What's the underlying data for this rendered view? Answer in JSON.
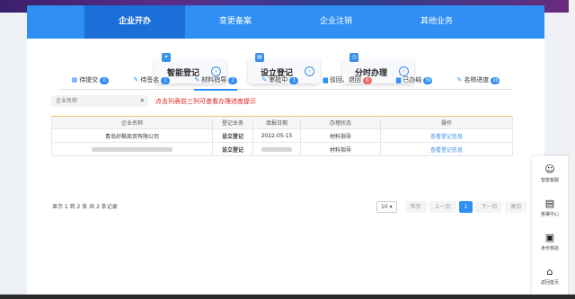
{
  "nav": {
    "items": [
      "企业开办",
      "变更备案",
      "企业注销",
      "其他业务"
    ],
    "active_index": 0
  },
  "quick_actions": [
    {
      "label": "智能登记",
      "arrow": "›"
    },
    {
      "label": "设立登记",
      "arrow": "›"
    },
    {
      "label": "分时办理",
      "arrow": "›"
    }
  ],
  "tabs": [
    {
      "icon": "list-icon",
      "label": "待提交",
      "count": "0"
    },
    {
      "icon": "edit-icon",
      "label": "待签名",
      "count": "1"
    },
    {
      "icon": "edit-icon",
      "label": "材料指导",
      "count": "2"
    },
    {
      "icon": "edit-icon",
      "label": "审批中",
      "count": "1"
    },
    {
      "icon": "folder-icon",
      "label": "驳回、退回",
      "count": "6"
    },
    {
      "icon": "folder-icon",
      "label": "已办结",
      "count": "39"
    },
    {
      "icon": "edit-icon",
      "label": "名称进度",
      "count": "20"
    }
  ],
  "search": {
    "placeholder": "企业名称",
    "icon": "search-icon"
  },
  "hint": "点击列表前三列可查看办理进度提示",
  "table": {
    "headers": [
      "企业名称",
      "登记业务",
      "填报日期",
      "办理状态",
      "操作"
    ],
    "rows": [
      {
        "name": "青岛好枫商贸有限公司",
        "business": "设立登记",
        "date": "2022-05-15",
        "status": "材料指导",
        "action": "查看登记信息"
      },
      {
        "name": "",
        "business": "设立登记",
        "date": "",
        "status": "材料指导",
        "action": "查看登记信息"
      }
    ]
  },
  "summary": "显示 1 到 2 条 共 2 条记录",
  "pager": {
    "page_size": "10",
    "first": "首页",
    "prev": "上一页",
    "current": "1",
    "next": "下一页",
    "last": "尾页"
  },
  "float_menu": [
    {
      "icon": "robot-icon",
      "label": "智能客服"
    },
    {
      "icon": "doc-icon",
      "label": "答署中心"
    },
    {
      "icon": "id-card-icon",
      "label": "身份核验"
    },
    {
      "icon": "home-icon",
      "label": "返回首页"
    }
  ],
  "colors": {
    "accent": "#2f8ff3",
    "hint": "#e02020",
    "badge_red": "#f06a6a"
  }
}
